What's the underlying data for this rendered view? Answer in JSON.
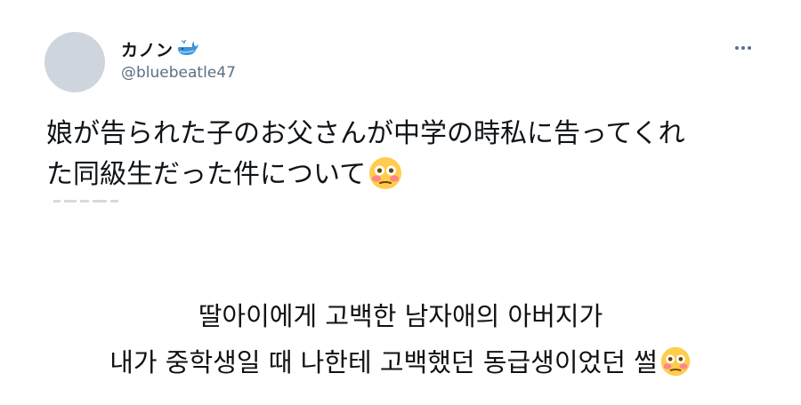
{
  "tweet": {
    "display_name": "カノン",
    "name_emoji": "whale-icon",
    "handle": "@bluebeatle47",
    "text_lines": [
      "娘が告られた子のお父さんが中学の時私に告ってくれ",
      "た同級生だった件について"
    ],
    "text_emoji": "flushed-face-icon"
  },
  "caption": {
    "lines": [
      "딸아이에게 고백한 남자애의 아버지가",
      "내가 중학생일 때 나한테 고백했던 동급생이었던 썰"
    ],
    "emoji": "flushed-face-icon"
  },
  "colors": {
    "background": "#ffffff",
    "text": "#0f1419",
    "secondary_text": "#5b7083",
    "avatar": "#cfd5dc",
    "whale": "#3b94d9"
  }
}
